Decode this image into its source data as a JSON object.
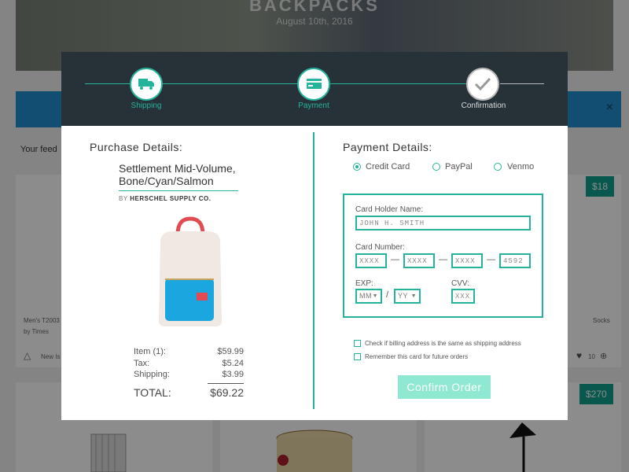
{
  "background": {
    "hero_title": "BACKPACKS",
    "hero_date": "August 10th, 2016",
    "feed_label": "Your feed",
    "card1_title": "Men's T2003",
    "card1_by": "by Times",
    "card1_new": "New Is",
    "card2_price": "$18",
    "card3_price": "$270",
    "socks": "Socks",
    "likes": "10",
    "close": "×"
  },
  "steps": [
    {
      "label": "Shipping",
      "icon": "truck-icon"
    },
    {
      "label": "Payment",
      "icon": "credit-card-icon"
    },
    {
      "label": "Confirmation",
      "icon": "check-icon"
    }
  ],
  "purchase": {
    "title": "Purchase Details:",
    "product_name": "Settlement Mid-Volume, Bone/Cyan/Salmon",
    "brand_by": "BY",
    "brand": "HERSCHEL SUPPLY CO.",
    "rows": [
      {
        "label": "Item (1):",
        "value": "$59.99"
      },
      {
        "label": "Tax:",
        "value": "$5.24"
      },
      {
        "label": "Shipping:",
        "value": "$3.99"
      }
    ],
    "total_label": "TOTAL:",
    "total_value": "$69.22"
  },
  "payment": {
    "title": "Payment Details:",
    "methods": [
      "Credit Card",
      "PayPal",
      "Venmo"
    ],
    "selected_method": "Credit Card",
    "holder_label": "Card Holder Name:",
    "holder_value": "JOHN H. SMITH",
    "number_label": "Card Number:",
    "number_parts": [
      "XXXX",
      "XXXX",
      "XXXX",
      "4592"
    ],
    "exp_label": "EXP:",
    "exp_month": "MM",
    "exp_year": "YY",
    "exp_sep": "/",
    "cvv_label": "CVV:",
    "cvv_value": "XXX",
    "checkbox_billing": "Check if billing address is the same as shipping address",
    "checkbox_remember": "Remember this card for future orders",
    "confirm_label": "Confirm Order"
  },
  "colors": {
    "accent": "#26b39b",
    "header": "#263238",
    "confirm_bg": "#8fe8d2",
    "price_tag": "#12a08e"
  }
}
